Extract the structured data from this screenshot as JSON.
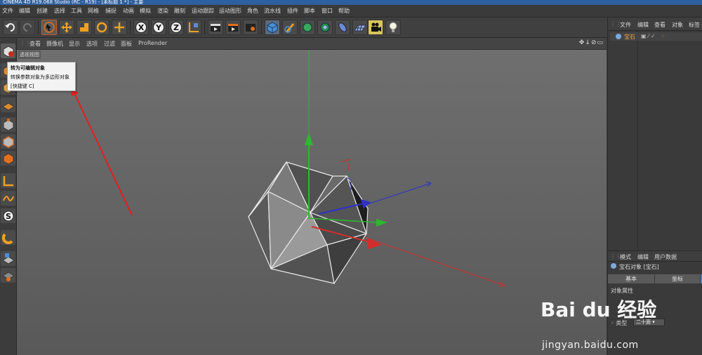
{
  "title": "CINEMA 4D R19.068 Studio (RC - R19) - [未标题 1 *] - 主要",
  "menu": [
    "文件",
    "编辑",
    "创建",
    "选择",
    "工具",
    "网格",
    "捕捉",
    "动画",
    "模拟",
    "渲染",
    "雕刻",
    "运动跟踪",
    "运动图形",
    "角色",
    "流水线",
    "插件",
    "脚本",
    "窗口",
    "帮助"
  ],
  "viewport_menu": [
    "查看",
    "摄像机",
    "显示",
    "选项",
    "过滤",
    "面板",
    "ProRender"
  ],
  "viewport_label": "透视视图",
  "tooltip": {
    "title": "转为可编辑对象",
    "desc": "转换参数对象为多边形对象",
    "shortcut": "[快捷键 C]"
  },
  "object_manager": {
    "tabs": [
      "文件",
      "编辑",
      "查看",
      "对象",
      "标签"
    ],
    "object_name": "宝石"
  },
  "attribute_manager": {
    "tabs": [
      "模式",
      "编辑",
      "用户数据"
    ],
    "title": "宝石对象 [宝石]",
    "subtabs": [
      "基本",
      "坐标"
    ],
    "section": "对象属性",
    "field_label": "类型",
    "field_value": "二十面"
  },
  "toolbar_icons": [
    "undo-icon",
    "redo-icon",
    "select-icon",
    "move-icon",
    "scale-icon",
    "rotate-icon",
    "live-select-icon",
    "x-axis-icon",
    "y-axis-icon",
    "z-axis-icon",
    "world-coords-icon",
    "render-view-icon",
    "render-picture-icon",
    "render-settings-icon",
    "cube-icon",
    "pen-icon",
    "subdivide-icon",
    "array-icon",
    "deformer-icon",
    "floor-icon",
    "camera-icon",
    "light-icon"
  ],
  "watermark": {
    "logo": "Bai du 经验",
    "url": "jingyan.baidu.com"
  },
  "colors": {
    "accent": "#2e5f9e",
    "axis_x": "#d22d2d",
    "axis_y": "#2db82d",
    "axis_z": "#3030c8"
  }
}
